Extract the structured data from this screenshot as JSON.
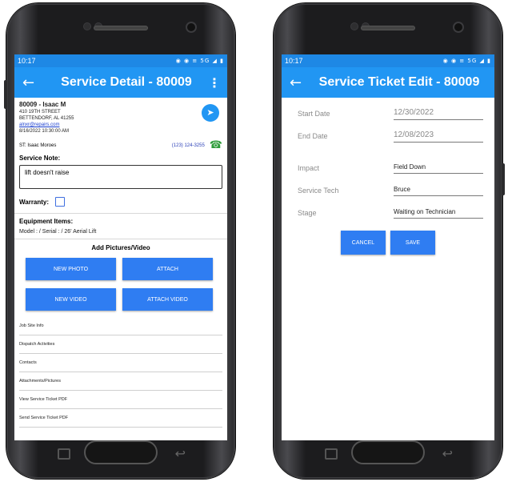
{
  "left_phone": {
    "status_time": "10:17",
    "status_icons": "◉ ◉ ≡ 5G ◢ ▮",
    "appbar": {
      "back_icon": "←",
      "title": "Service Detail - 80009",
      "menu_icon": "⋮"
    },
    "customer": {
      "name": "80009 - Isaac M",
      "address1": "410 19TH STREET",
      "address2": "BETTENDORF, AL 41255",
      "email": "alnxr@repairs.com",
      "datetime": "8/16/2022 10:30:00 AM",
      "nav_icon": "➤"
    },
    "service_tech": {
      "label": "ST: Isaac Moroes",
      "phone": "(123) 124-3255",
      "phone_icon": "☎"
    },
    "service_note": {
      "label": "Service Note:",
      "value": "lift doesn't raise"
    },
    "warranty_label": "Warranty:",
    "equipment": {
      "title": "Equipment Items:",
      "line": "Model : / Serial : / 26' Aerial Lift"
    },
    "add_pictures_title": "Add Pictures/Video",
    "buttons": {
      "new_photo": "NEW PHOTO",
      "attach": "ATTACH",
      "new_video": "NEW VIDEO",
      "attach_video": "ATTACH VIDEO"
    },
    "menu_items": [
      "Job Site Info",
      "Dispatch Activities",
      "Contacts",
      "Attachments/Pictures",
      "View Service Ticket PDF",
      "Send Service Ticket PDF"
    ]
  },
  "right_phone": {
    "status_time": "10:17",
    "status_icons": "◉ ◉ ≡ 5G ◢ ▮",
    "appbar": {
      "back_icon": "←",
      "title": "Service Ticket Edit - 80009"
    },
    "fields": {
      "start_date": {
        "label": "Start Date",
        "value": "12/30/2022"
      },
      "end_date": {
        "label": "End Date",
        "value": "12/08/2023"
      },
      "impact": {
        "label": "Impact",
        "value": "Field Down"
      },
      "service_tech": {
        "label": "Service Tech",
        "value": "Bruce"
      },
      "stage": {
        "label": "Stage",
        "value": "Waiting on Technician"
      }
    },
    "buttons": {
      "cancel": "CANCEL",
      "save": "SAVE"
    }
  },
  "colors": {
    "app_bar": "#2196f3",
    "status_bar": "#1e88e5",
    "button": "#2f7df2",
    "phone_icon": "#2e9c3a"
  },
  "hardware": {
    "back_glyph": "↩"
  }
}
